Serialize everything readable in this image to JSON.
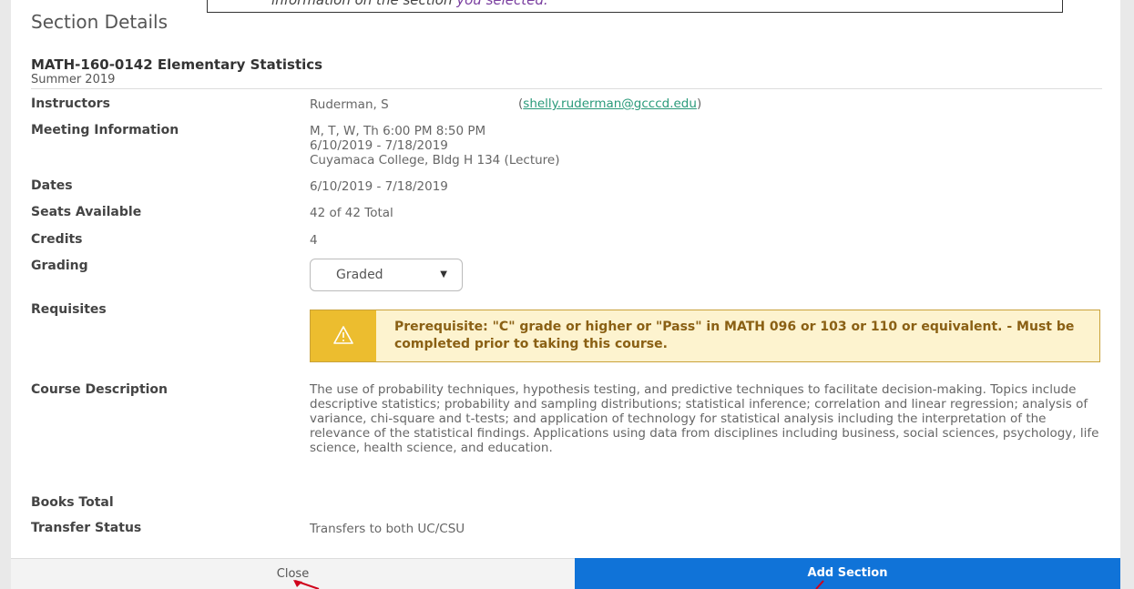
{
  "callout": {
    "text_prefix": "information on the section ",
    "text_emph": "you selected."
  },
  "modal": {
    "title": "Section Details",
    "course_title": "MATH-160-0142 Elementary Statistics",
    "term": "Summer 2019"
  },
  "fields": {
    "instructors_label": "Instructors",
    "instructor_name": "Ruderman, S",
    "instructor_email": "shelly.ruderman@gcccd.edu",
    "meeting_label": "Meeting Information",
    "meeting_days": "M, T, W, Th 6:00 PM 8:50 PM",
    "meeting_dates": "6/10/2019 - 7/18/2019",
    "meeting_location": "Cuyamaca College, Bldg H 134 (Lecture)",
    "dates_label": "Dates",
    "dates_value": "6/10/2019 - 7/18/2019",
    "seats_label": "Seats Available",
    "seats_value": "42 of 42 Total",
    "credits_label": "Credits",
    "credits_value": "4",
    "grading_label": "Grading",
    "grading_selected": "Graded",
    "requisites_label": "Requisites",
    "requisite_text": "Prerequisite: \"C\" grade or higher or \"Pass\" in MATH 096 or 103 or 110 or equivalent. - Must be completed prior to taking this course.",
    "description_label": "Course Description",
    "description_text": "The use of probability techniques, hypothesis testing, and predictive techniques to facilitate decision-making. Topics include descriptive statistics; probability and sampling distributions; statistical inference; correlation and linear regression; analysis of variance, chi-square and t-tests; and application of technology for statistical analysis including the interpretation of the relevance of the statistical findings. Applications using data from disciplines including business, social sciences, psychology, life science, health science, and education.",
    "books_label": "Books Total",
    "transfer_label": "Transfer Status",
    "transfer_value": "Transfers to both UC/CSU"
  },
  "footer": {
    "close_label": "Close",
    "add_label": "Add Section"
  },
  "icons": {
    "warning": "warning-icon",
    "caret": "chevron-down-icon"
  },
  "colors": {
    "accent": "#1073d8",
    "warning_bg": "#fdf3cf",
    "warning_icon_bg": "#ecbd2f",
    "warning_text": "#8a6014",
    "link": "#2a9a7a"
  }
}
